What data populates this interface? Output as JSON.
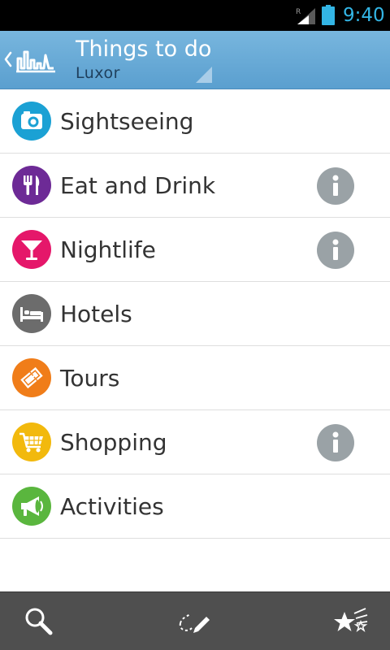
{
  "status_bar": {
    "time": "9:40",
    "roaming_indicator": "R",
    "icons": [
      "signal-icon",
      "battery-icon"
    ],
    "accent_color": "#33b5e5"
  },
  "action_bar": {
    "title": "Things to do",
    "subtitle": "Luxor",
    "logo_icon": "app-logo-icon",
    "background_color": "#6aaad7"
  },
  "categories": [
    {
      "label": "Sightseeing",
      "icon": "camera-icon",
      "color": "#1ba1d4",
      "info": false
    },
    {
      "label": "Eat and Drink",
      "icon": "fork-knife-icon",
      "color": "#6d2a96",
      "info": true
    },
    {
      "label": "Nightlife",
      "icon": "cocktail-icon",
      "color": "#e5176a",
      "info": true
    },
    {
      "label": "Hotels",
      "icon": "bed-icon",
      "color": "#6c6c6c",
      "info": false
    },
    {
      "label": "Tours",
      "icon": "ticket-icon",
      "color": "#f07d19",
      "info": false
    },
    {
      "label": "Shopping",
      "icon": "cart-icon",
      "color": "#f2b90d",
      "info": true
    },
    {
      "label": "Activities",
      "icon": "megaphone-icon",
      "color": "#5ab63e",
      "info": false
    }
  ],
  "bottom_bar": {
    "buttons": [
      "search-icon",
      "route-pencil-icon",
      "favorites-stars-icon"
    ]
  }
}
